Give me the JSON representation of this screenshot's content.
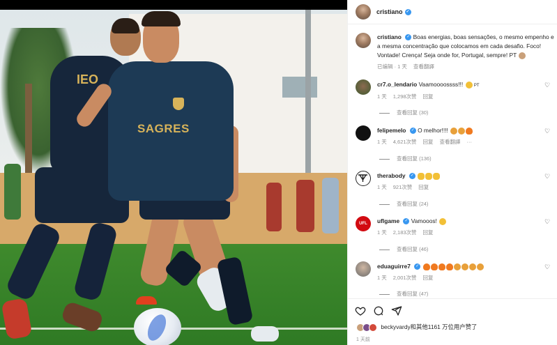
{
  "header": {
    "username": "cristiano"
  },
  "caption": {
    "username": "cristiano",
    "text": "Boas energias, boas sensações, o mesmo empenho e a mesma concentração que colocamos em cada desafio. Foco! Vontade! Crença! Seja onde for, Portugal, sempre! PT",
    "edited": "已编辑 · 1 天",
    "translate": "查看翻譯"
  },
  "comments": [
    {
      "username": "cr7.o_lendario",
      "verified": false,
      "text": "Vaamoooossss!!!",
      "suffix": "PT",
      "time": "1 天",
      "likes": "1,298次赞",
      "reply": "回复",
      "extra": "",
      "replies": "查看回复 (30)"
    },
    {
      "username": "felipemelo",
      "verified": true,
      "text": "O melhor!!!!",
      "suffix": "",
      "time": "1 天",
      "likes": "4,621次赞",
      "reply": "回复",
      "extra": "查看翻譯",
      "replies": "查看回复 (136)"
    },
    {
      "username": "therabody",
      "verified": true,
      "text": "",
      "suffix": "",
      "time": "1 天",
      "likes": "921次赞",
      "reply": "回复",
      "extra": "",
      "replies": "查看回复 (24)"
    },
    {
      "username": "uflgame",
      "verified": true,
      "text": "Vamooos!",
      "suffix": "",
      "time": "1 天",
      "likes": "2,183次赞",
      "reply": "回复",
      "extra": "",
      "replies": "查看回复 (46)"
    },
    {
      "username": "eduaguirre7",
      "verified": true,
      "text": "",
      "suffix": "",
      "time": "1 天",
      "likes": "2,001次赞",
      "reply": "回复",
      "extra": "",
      "replies": "查看回复 (47)"
    }
  ],
  "likes_summary": "beckyvardy和其他1161 万位用户赞了",
  "post_time": "1 天前",
  "photo": {
    "jersey_text": "SAGRES",
    "back_text": "IEO"
  },
  "colors": {
    "verified": "#3897f0",
    "muted": "#8e8e8e",
    "text": "#262626"
  }
}
